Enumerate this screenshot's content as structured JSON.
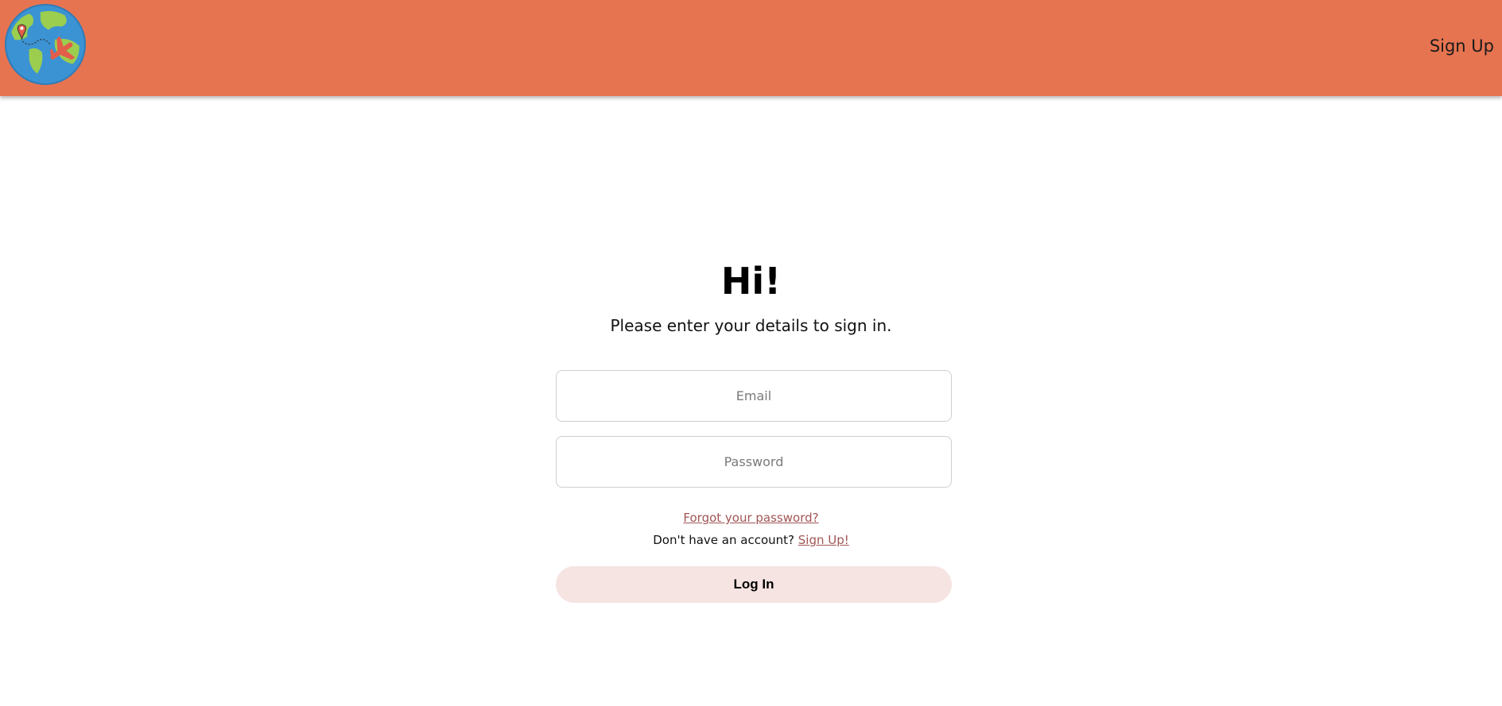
{
  "header": {
    "nav_signup_label": "Sign Up",
    "background_color": "#e77450",
    "logo_icon": "globe-airplane-logo-icon"
  },
  "login": {
    "title": "Hi!",
    "subtitle": "Please enter your details to sign in.",
    "email": {
      "placeholder": "Email",
      "value": ""
    },
    "password": {
      "placeholder": "Password",
      "value": ""
    },
    "forgot_password_link": "Forgot your password?",
    "no_account_text": "Don't have an account?",
    "signup_link": "Sign Up!",
    "login_button_label": "Log In",
    "link_color": "#a15555",
    "button_color": "#f5e4e2"
  }
}
